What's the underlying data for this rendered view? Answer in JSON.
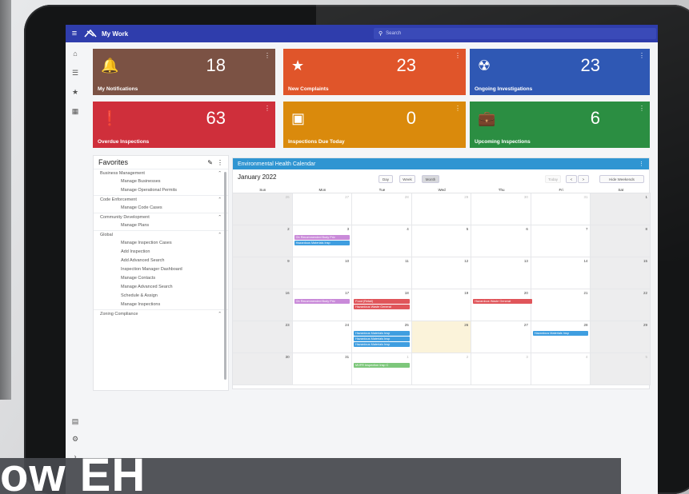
{
  "app": {
    "title": "My Work"
  },
  "search": {
    "placeholder": "Search"
  },
  "tiles": [
    {
      "value": "18",
      "label": "My Notifications",
      "color": "#7b5244",
      "icon": "bell-icon"
    },
    {
      "value": "23",
      "label": "New Complaints",
      "color": "#e0552a",
      "icon": "star-icon"
    },
    {
      "value": "23",
      "label": "Ongoing Investigations",
      "color": "#2f58b4",
      "icon": "radiation-icon"
    },
    {
      "value": "63",
      "label": "Overdue Inspections",
      "color": "#cf2f3b",
      "icon": "clipboard-alert-icon"
    },
    {
      "value": "0",
      "label": "Inspections Due Today",
      "color": "#da8a0c",
      "icon": "calendar-icon"
    },
    {
      "value": "6",
      "label": "Upcoming Inspections",
      "color": "#2b8e42",
      "icon": "briefcase-icon"
    }
  ],
  "favorites": {
    "title": "Favorites",
    "groups": [
      {
        "label": "Business Management",
        "items": [
          "Manage Businesses",
          "Manage Operational Permits"
        ]
      },
      {
        "label": "Code Enforcement",
        "items": [
          "Manage Code Cases"
        ]
      },
      {
        "label": "Community Development",
        "items": [
          "Manage Plans"
        ]
      },
      {
        "label": "Global",
        "items": [
          "Manage Inspection Cases",
          "Add Inspection",
          "Add Advanced Search",
          "Inspection Manager Dashboard",
          "Manage Contacts",
          "Manage Advanced Search",
          "Schedule & Assign",
          "Manage Inspections"
        ]
      },
      {
        "label": "Zoning Compliance",
        "items": []
      }
    ]
  },
  "calendar": {
    "title": "Environmental Health Calendar",
    "month": "January 2022",
    "views": [
      "Day",
      "Week",
      "Month"
    ],
    "active_view": "Month",
    "today_label": "Today",
    "prev": "<",
    "next": ">",
    "hide_weekends": "Hide Weekends",
    "weekdays": [
      "Sun",
      "Mon",
      "Tue",
      "Wed",
      "Thu",
      "Fri",
      "Sat"
    ],
    "weeks": [
      [
        "26",
        "27",
        "28",
        "29",
        "30",
        "31",
        "1"
      ],
      [
        "2",
        "3",
        "4",
        "5",
        "6",
        "7",
        "8"
      ],
      [
        "9",
        "10",
        "11",
        "12",
        "13",
        "14",
        "15"
      ],
      [
        "16",
        "17",
        "18",
        "19",
        "20",
        "21",
        "22"
      ],
      [
        "23",
        "24",
        "25",
        "26",
        "27",
        "28",
        "29"
      ],
      [
        "30",
        "31",
        "1",
        "2",
        "3",
        "4",
        "5"
      ]
    ],
    "events": [
      {
        "week": 1,
        "day": 1,
        "slot": 0,
        "text": "On Recommended Body Priv",
        "color": "#c98ad9"
      },
      {
        "week": 1,
        "day": 1,
        "slot": 1,
        "text": "Hazardous Materials Insp",
        "color": "#3f9ee0"
      },
      {
        "week": 3,
        "day": 1,
        "slot": 0,
        "text": "On Recommended Body Priv",
        "color": "#c98ad9"
      },
      {
        "week": 3,
        "day": 2,
        "slot": 0,
        "text": "Food (Retail)",
        "color": "#e0555a"
      },
      {
        "week": 3,
        "day": 2,
        "slot": 1,
        "text": "Hazardous Waste Generat",
        "color": "#e0555a"
      },
      {
        "week": 3,
        "day": 4,
        "slot": 0,
        "text": "Hazardous Waste Generat",
        "color": "#e0555a"
      },
      {
        "week": 4,
        "day": 2,
        "slot": 0,
        "text": "Hazardous Materials Insp",
        "color": "#3f9ee0"
      },
      {
        "week": 4,
        "day": 2,
        "slot": 1,
        "text": "Hazardous Materials Insp",
        "color": "#3f9ee0"
      },
      {
        "week": 4,
        "day": 2,
        "slot": 2,
        "text": "Hazardous Materials Insp",
        "color": "#3f9ee0"
      },
      {
        "week": 4,
        "day": 5,
        "slot": 0,
        "text": "Hazardous Materials Insp",
        "color": "#3f9ee0"
      },
      {
        "week": 5,
        "day": 2,
        "slot": 0,
        "text": "MVFR Inspection Insp C",
        "color": "#7dc77b"
      }
    ]
  },
  "banner": {
    "text": "ow EH"
  }
}
